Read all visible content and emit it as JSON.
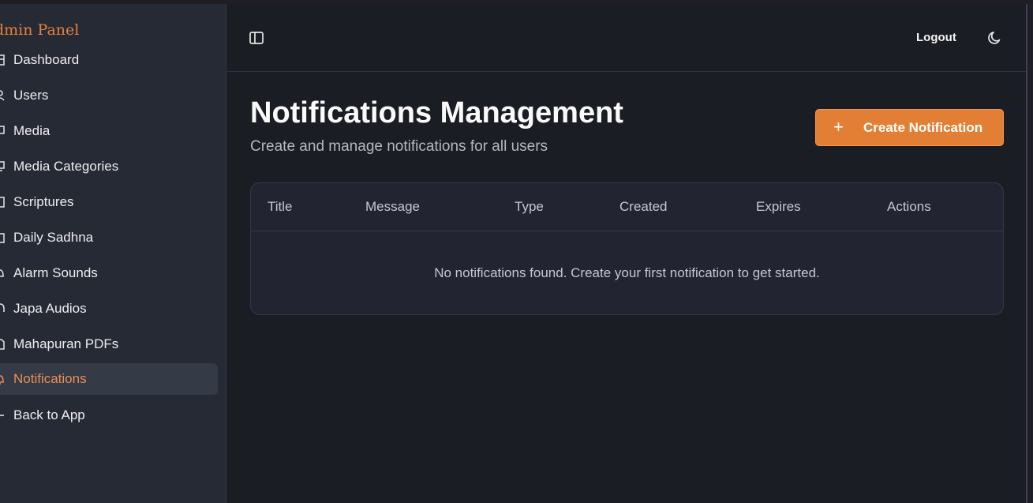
{
  "sidebar": {
    "brand": "dmin Panel",
    "items": [
      {
        "label": "Dashboard",
        "icon": "dashboard-icon"
      },
      {
        "label": "Users",
        "icon": "users-icon"
      },
      {
        "label": "Media",
        "icon": "media-icon"
      },
      {
        "label": "Media Categories",
        "icon": "categories-icon"
      },
      {
        "label": "Scriptures",
        "icon": "book-icon"
      },
      {
        "label": "Daily Sadhna",
        "icon": "calendar-icon"
      },
      {
        "label": "Alarm Sounds",
        "icon": "bell-icon"
      },
      {
        "label": "Japa Audios",
        "icon": "headphones-icon"
      },
      {
        "label": "Mahapuran PDFs",
        "icon": "file-icon"
      },
      {
        "label": "Notifications",
        "icon": "bell-ring-icon",
        "active": true
      },
      {
        "label": "Back to App",
        "icon": "arrow-left-icon"
      }
    ]
  },
  "header": {
    "logout_label": "Logout"
  },
  "main": {
    "title": "Notifications Management",
    "subtitle": "Create and manage notifications for all users",
    "create_button_label": "Create Notification",
    "table": {
      "columns": [
        "Title",
        "Message",
        "Type",
        "Created",
        "Expires",
        "Actions"
      ],
      "empty_message": "No notifications found. Create your first notification to get started."
    }
  },
  "colors": {
    "accent": "#e37f34",
    "background": "#1b1d25",
    "sidebar": "#262a35"
  }
}
